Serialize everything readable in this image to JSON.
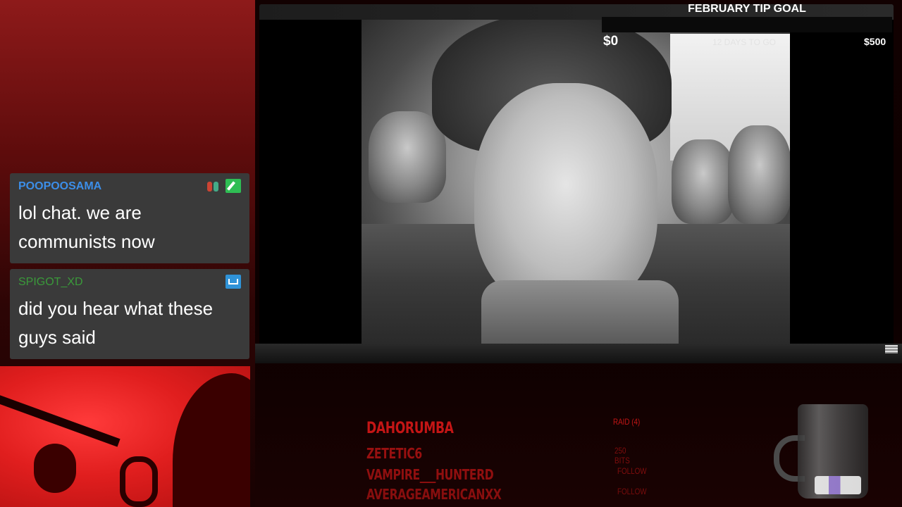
{
  "tip_goal": {
    "title": "FEBRUARY TIP GOAL",
    "current": "$0",
    "days_left": "12 DAYS TO GO",
    "target": "$500",
    "progress": 0
  },
  "chat": {
    "messages": [
      {
        "username": "POOPOOSAMA",
        "text": "lol chat. we are communists now",
        "username_color": "#3c8ee8"
      },
      {
        "username": "SPIGOT_XD",
        "text": "did you hear what these guys said",
        "username_color": "#3a9a3a"
      }
    ]
  },
  "events": {
    "latest": {
      "name": "DAHORUMBA",
      "type": "RAID (4)"
    },
    "recent": [
      {
        "name": "ZETETIC6",
        "type": "250 BITS"
      },
      {
        "name": "VAMPIRE___HUNTERD",
        "type": "FOLLOW"
      },
      {
        "name": "AVERAGEAMERICANXX",
        "type": "FOLLOW"
      }
    ],
    "accent_color": "#c41515"
  }
}
